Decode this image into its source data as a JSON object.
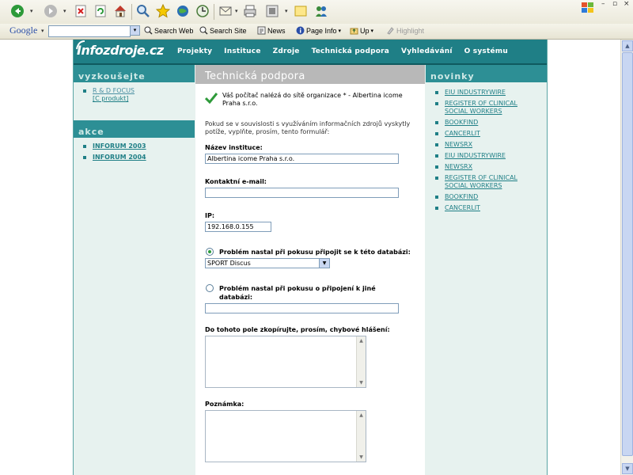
{
  "browser": {
    "toolbar_icons": [
      "back-icon",
      "forward-icon",
      "stop-icon",
      "refresh-icon",
      "home-icon",
      "search-icon",
      "favorites-icon",
      "media-icon",
      "history-icon",
      "mail-icon",
      "print-icon",
      "edit-icon",
      "discuss-icon",
      "messenger-icon"
    ],
    "google_bar": {
      "logo": "Google",
      "search_web": "Search Web",
      "search_site": "Search Site",
      "news": "News",
      "page_info": "Page Info",
      "up": "Up",
      "highlight": "Highlight"
    },
    "colors": {
      "chrome": "#ebe9db",
      "accent": "#2a4ea8"
    }
  },
  "site": {
    "logo": "Infozdroje.cz",
    "nav": [
      "Projekty",
      "Instituce",
      "Zdroje",
      "Technická podpora",
      "Vyhledávání",
      "O systému"
    ],
    "colors": {
      "nav_bg": "#1f7f86",
      "sidebar_bg": "#e7f2ef",
      "heading_bg": "#2d8f95",
      "title_bg": "#b8b8b8"
    }
  },
  "left_sidebar": {
    "heading1": "vyzkoušejte",
    "try_items": [
      {
        "line1": "R & D FOCUS",
        "line2": "[C produkt]"
      }
    ],
    "heading2": "akce",
    "event_items": [
      "INFORUM 2003",
      "INFORUM 2004"
    ]
  },
  "main": {
    "title": "Technická podpora",
    "notice": "Váš počítač nalézá do sítě organizace * - Albertina icome Praha s.r.o.",
    "intro": "Pokud se v souvislosti s využíváním informačních zdrojů vyskytly potíže, vyplňte, prosím, tento formulář:",
    "institution_label": "Název instituce:",
    "institution_value": "Albertina icome Praha s.r.o.",
    "email_label": "Kontaktní e-mail:",
    "email_value": "",
    "ip_label": "IP:",
    "ip_value": "192.168.0.155",
    "radio1_label": "Problém nastal při pokusu připojit se k této databázi:",
    "select_value": "SPORT Discus",
    "radio2_label": "Problém nastal při pokusu o připojení k jiné databázi:",
    "other_db_value": "",
    "error_label": "Do tohoto pole zkopírujte, prosím, chybové hlášení:",
    "note_label": "Poznámka:"
  },
  "right_sidebar": {
    "heading": "novinky",
    "items": [
      {
        "line1": "EIU INDUSTRYWIRE",
        "line2": ""
      },
      {
        "line1": "REGISTER OF CLINICAL",
        "line2": "SOCIAL WORKERS"
      },
      {
        "line1": "BOOKFIND",
        "line2": ""
      },
      {
        "line1": "CANCERLIT",
        "line2": ""
      },
      {
        "line1": "NEWSRX",
        "line2": ""
      },
      {
        "line1": "EIU INDUSTRYWIRE",
        "line2": ""
      },
      {
        "line1": "NEWSRX",
        "line2": ""
      },
      {
        "line1": "REGISTER OF CLINICAL",
        "line2": "SOCIAL WORKERS"
      },
      {
        "line1": "BOOKFIND",
        "line2": ""
      },
      {
        "line1": "CANCERLIT",
        "line2": ""
      }
    ]
  }
}
